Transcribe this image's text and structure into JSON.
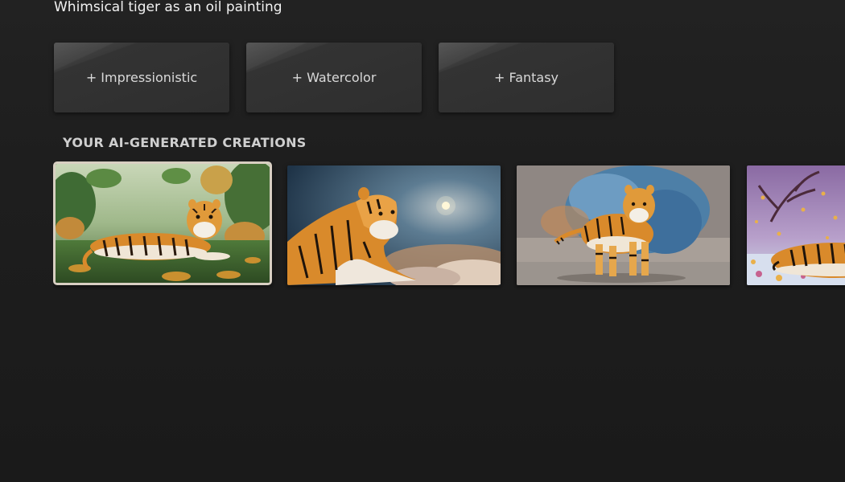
{
  "prompt": {
    "title": "Whimsical tiger as an oil painting"
  },
  "style_options": [
    {
      "label": "+ Impressionistic"
    },
    {
      "label": "+ Watercolor"
    },
    {
      "label": "+ Fantasy"
    }
  ],
  "creations": {
    "heading": "YOUR AI-GENERATED CREATIONS",
    "items": [
      {
        "description": "tiger-lying-in-jungle",
        "focused": true
      },
      {
        "description": "tiger-under-moon-clouds",
        "focused": false
      },
      {
        "description": "tiger-walking-blue-smoke",
        "focused": false
      },
      {
        "description": "tiger-sleeping-purple-tree",
        "focused": false
      }
    ]
  },
  "colors": {
    "background": "#1b1b1b",
    "button": "#333333",
    "focus_border": "#d8cfc2",
    "tiger_orange": "#d98a2b"
  }
}
